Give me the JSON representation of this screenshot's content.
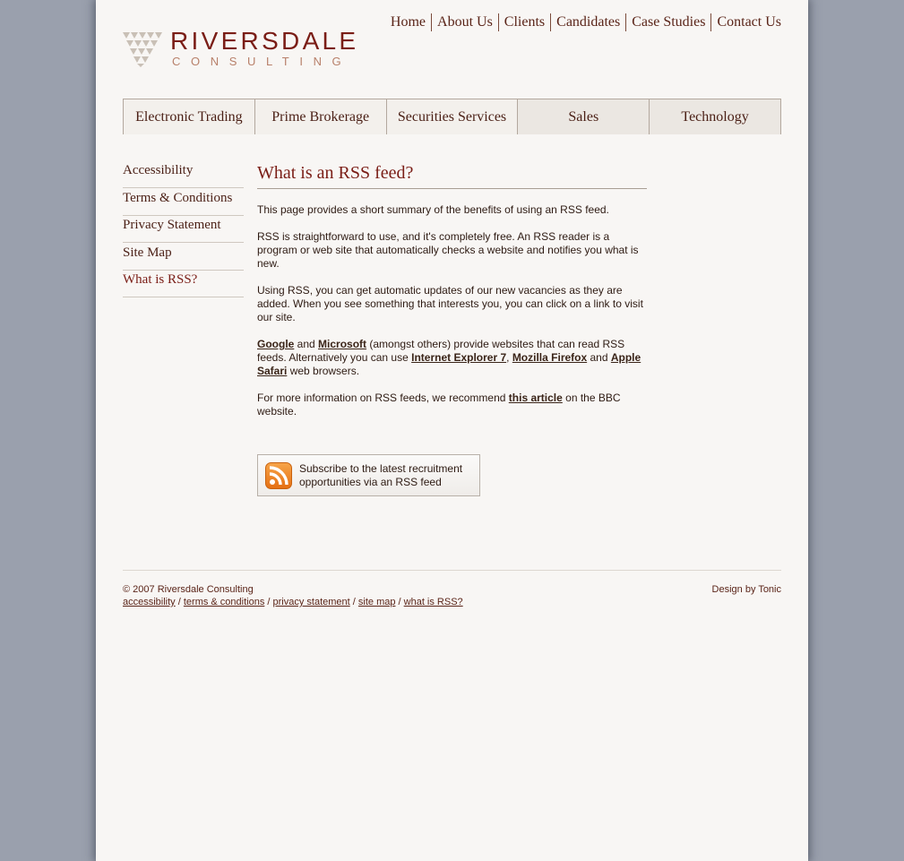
{
  "logo": {
    "name": "RIVERSDALE",
    "sub": "CONSULTING"
  },
  "topnav": [
    "Home",
    "About Us",
    "Clients",
    "Candidates",
    "Case Studies",
    "Contact Us"
  ],
  "tabs": [
    "Electronic Trading",
    "Prime Brokerage",
    "Securities Services",
    "Sales",
    "Technology"
  ],
  "sidebar": [
    "Accessibility",
    "Terms & Conditions",
    "Privacy Statement",
    "Site Map",
    "What is RSS?"
  ],
  "content": {
    "title": "What is an RSS feed?",
    "p1": "This page provides a short summary of the benefits of using an RSS feed.",
    "p2": "RSS is straightforward to use, and it's completely free. An RSS reader is a program or web site that automatically checks a website and notifies you what is new.",
    "p3": "Using RSS, you can get automatic updates of our new vacancies as they are added. When you see something that interests you, you can click on a link to visit our site.",
    "p4": {
      "link_google": "Google",
      "and1": " and ",
      "link_microsoft": "Microsoft",
      "text1": " (amongst others) provide websites that can read RSS feeds. Alternatively you can use ",
      "link_ie": "Internet Explorer 7",
      "comma": ", ",
      "link_firefox": "Mozilla Firefox",
      "and2": " and ",
      "link_safari": "Apple Safari",
      "text2": " web browsers."
    },
    "p5": {
      "text1": "For more information on RSS feeds, we recommend ",
      "link_article": "this article",
      "text2": " on the BBC website."
    },
    "rss_button": "Subscribe to the latest recruitment opportunities via an RSS feed"
  },
  "footer": {
    "copyright": "© 2007 Riversdale Consulting",
    "links": [
      "accessibility",
      "terms & conditions",
      "privacy statement",
      "site map",
      "what is RSS?"
    ],
    "separator": " / ",
    "design": "Design by Tonic"
  },
  "colors": {
    "brand": "#7a1d16",
    "background": "#9aa0ad",
    "page": "#f8f6f4",
    "rss": "#f08a24"
  },
  "icons": [
    "logo-triangles-icon",
    "rss-icon"
  ]
}
